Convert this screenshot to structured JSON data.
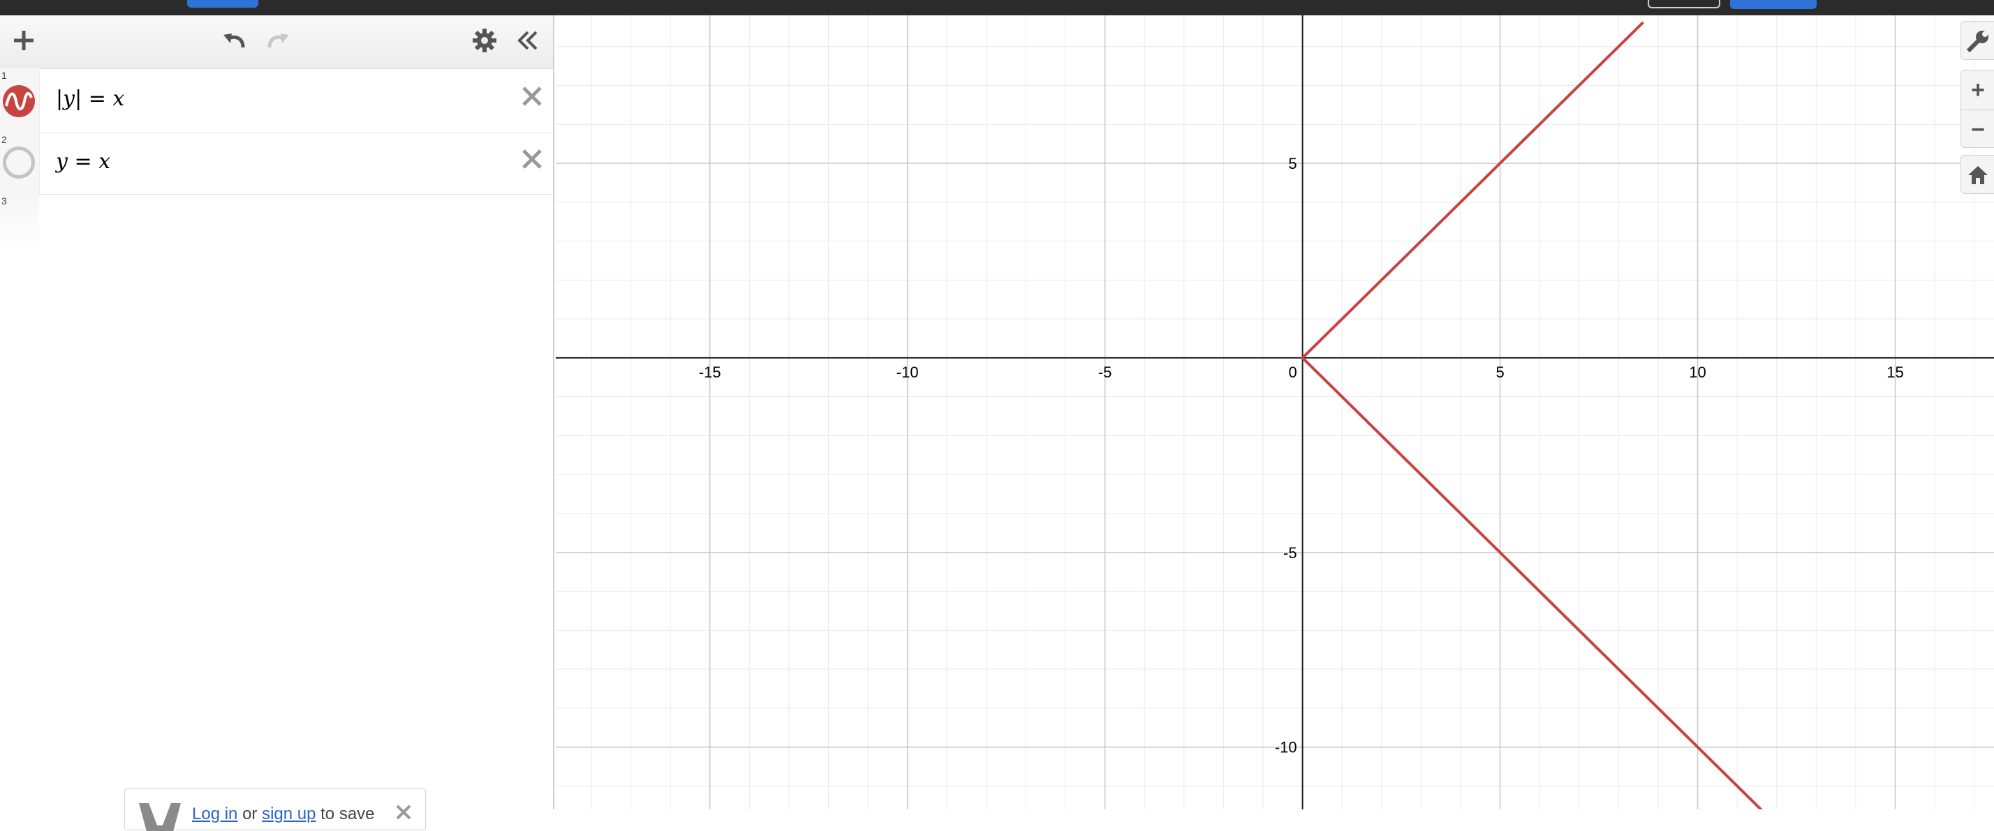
{
  "toolbar": {
    "add_icon": "plus-icon",
    "undo_icon": "undo-icon",
    "redo_icon": "redo-icon",
    "settings_icon": "gear-icon",
    "collapse_icon": "double-chevron-left-icon"
  },
  "expressions": [
    {
      "number": "1",
      "latex": "|y| = x",
      "lhs": "y",
      "eq": "=",
      "rhs": "x",
      "color": "#c74440",
      "visible": true
    },
    {
      "number": "2",
      "latex": "y = x",
      "lhs": "y",
      "eq": "=",
      "rhs": "x",
      "color": "#c74440",
      "visible": false
    },
    {
      "number": "3"
    }
  ],
  "login_prompt": {
    "login": "Log in",
    "or": "or",
    "signup": "sign up",
    "to_save": "to save"
  },
  "graph_controls": {
    "settings_icon": "wrench-icon",
    "zoom_in": "+",
    "zoom_out": "−",
    "home_icon": "home-icon"
  },
  "chart_data": {
    "type": "line",
    "xlim": [
      -18.9,
      17.5
    ],
    "ylim": [
      -11.6,
      8.8
    ],
    "grid": true,
    "x_ticks": [
      "-15",
      "-10",
      "-5",
      "0",
      "5",
      "10",
      "15"
    ],
    "y_ticks": [
      "5",
      "-5",
      "-10"
    ],
    "series": [
      {
        "points": [
          [
            0,
            0
          ],
          [
            8.6,
            8.6
          ]
        ],
        "color": "#c74440"
      },
      {
        "points": [
          [
            0,
            0
          ],
          [
            11.6,
            -11.6
          ]
        ],
        "color": "#c74440"
      }
    ]
  }
}
